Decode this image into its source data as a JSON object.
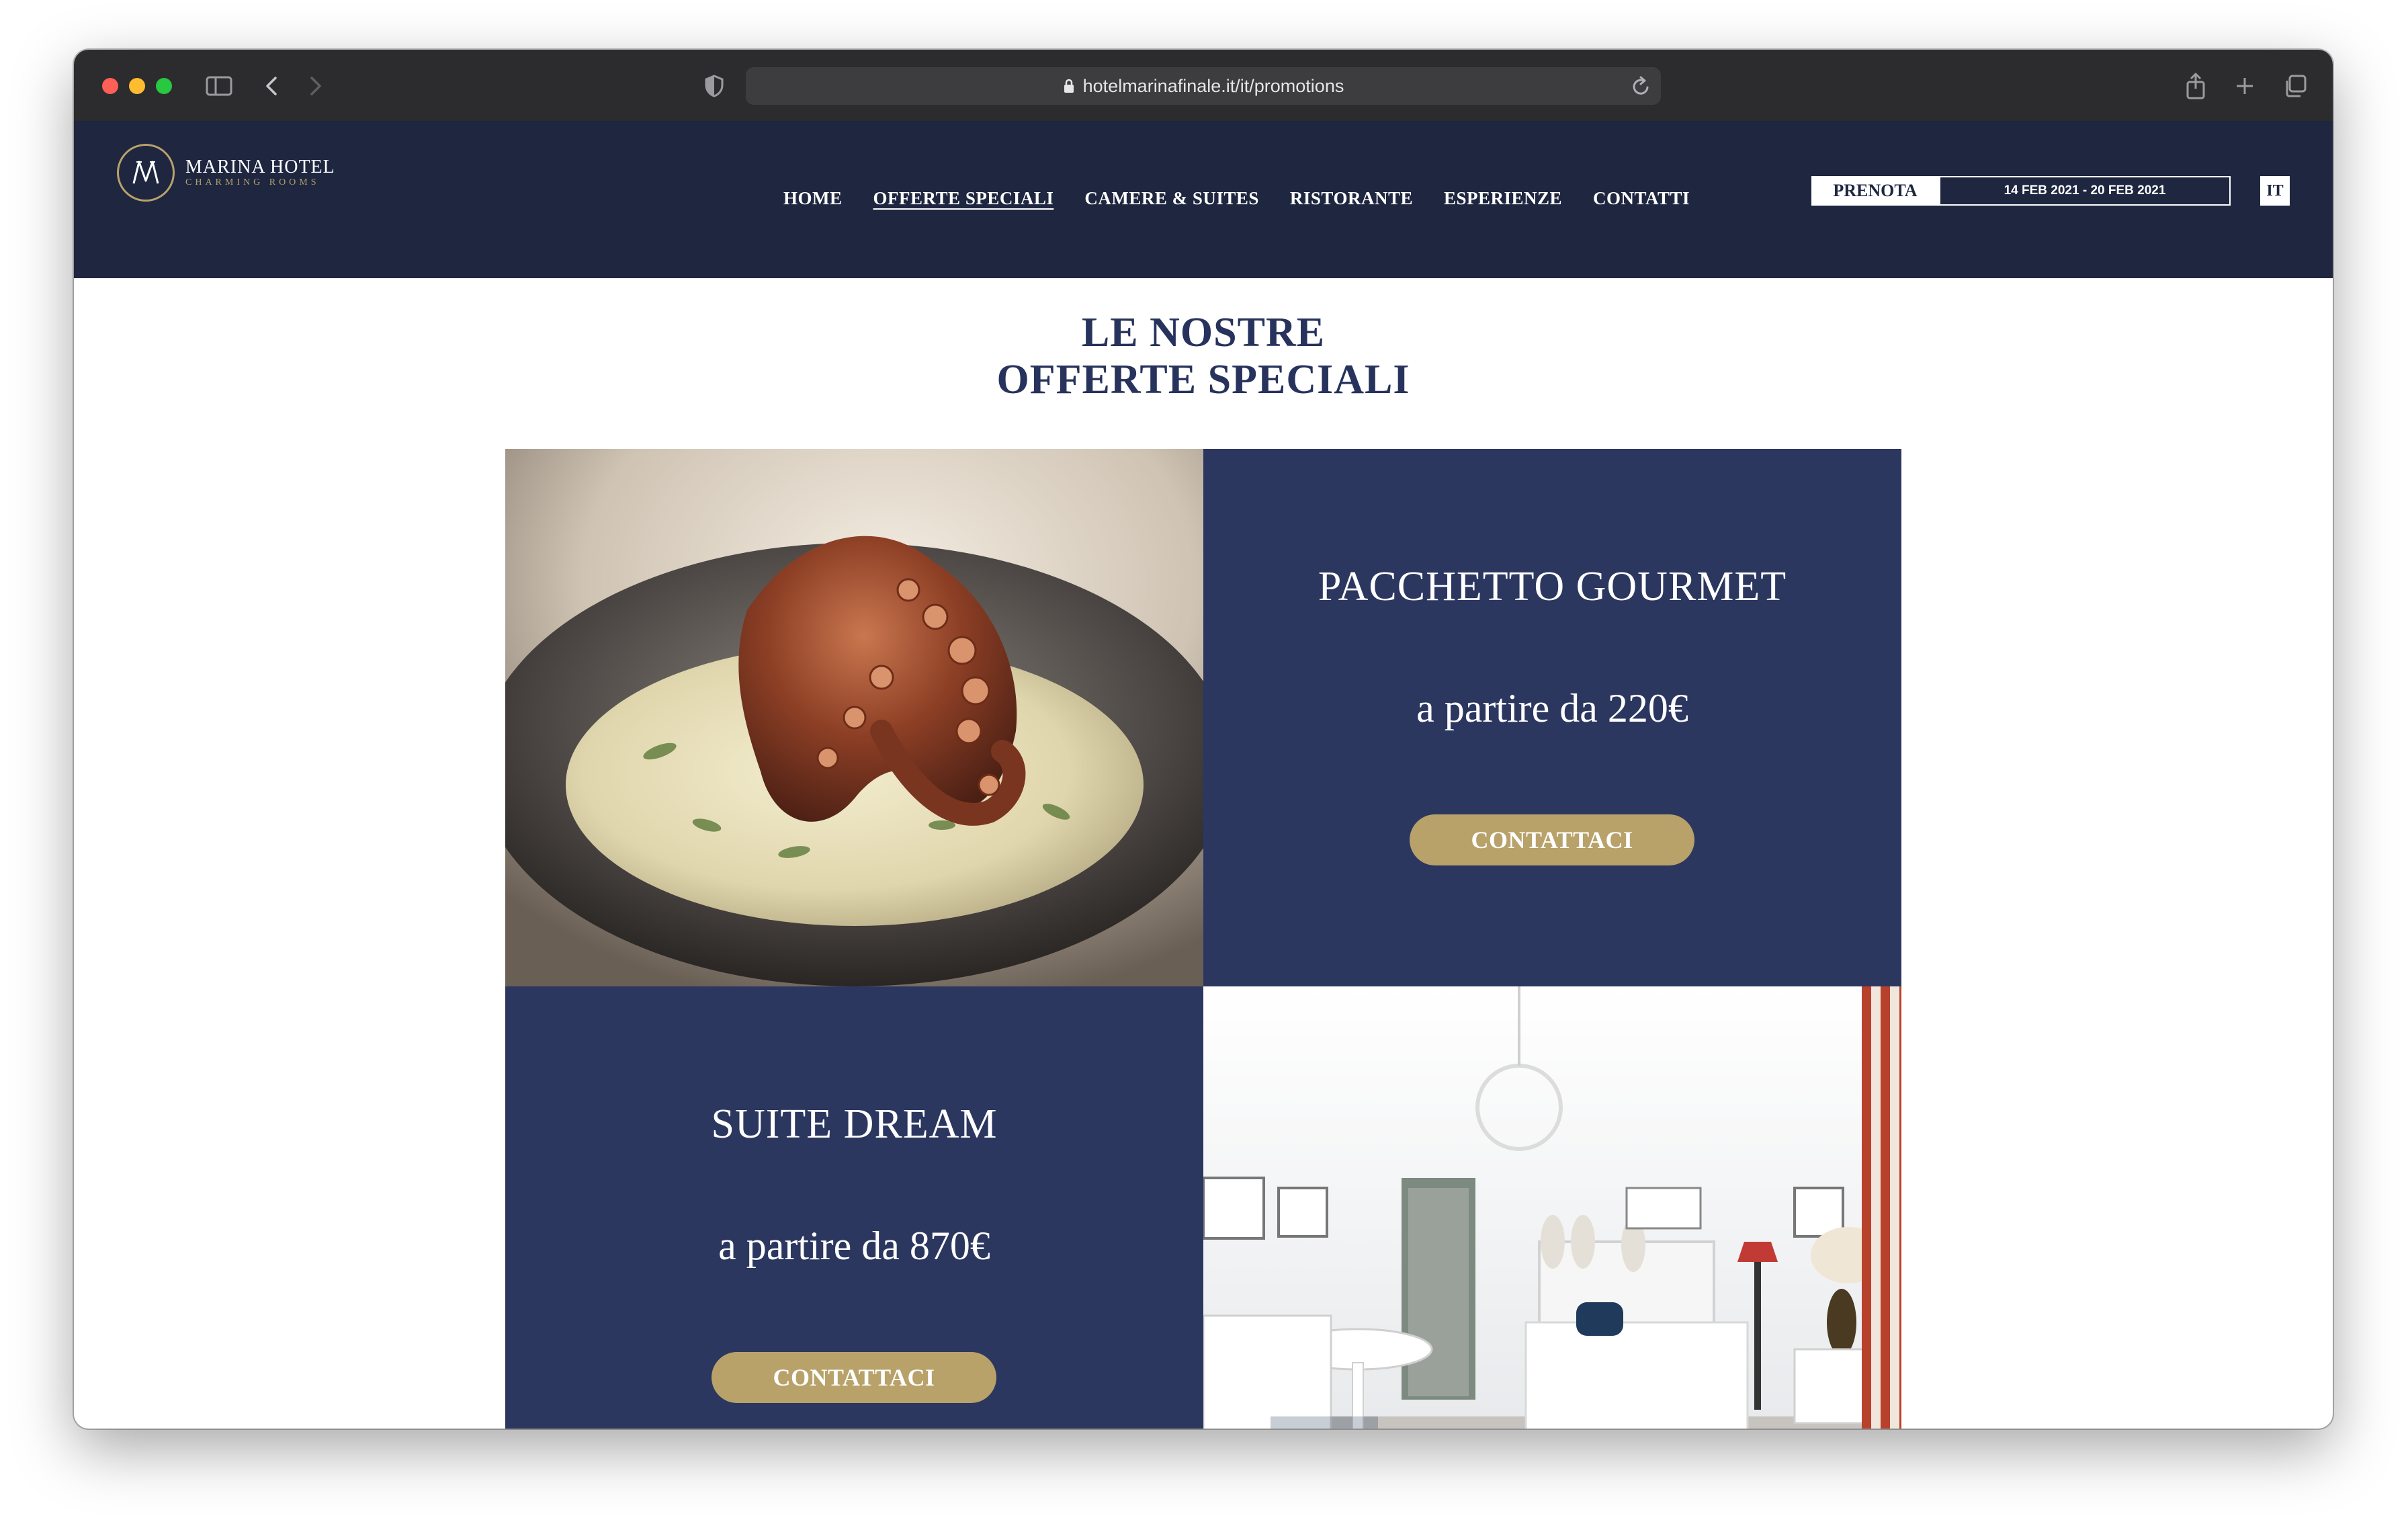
{
  "browser": {
    "url": "hotelmarinafinale.it/it/promotions"
  },
  "site": {
    "logo": {
      "title": "MARINA HOTEL",
      "subtitle": "CHARMING ROOMS"
    },
    "nav": [
      {
        "label": "HOME"
      },
      {
        "label": "OFFERTE SPECIALI",
        "active": true
      },
      {
        "label": "CAMERE & SUITES"
      },
      {
        "label": "RISTORANTE"
      },
      {
        "label": "ESPERIENZE"
      },
      {
        "label": "CONTATTI"
      }
    ],
    "booking": {
      "button_label": "PRENOTA",
      "dates": "14 FEB 2021 - 20 FEB 2021"
    },
    "language": "IT"
  },
  "main": {
    "title_line1": "LE NOSTRE",
    "title_line2": "OFFERTE SPECIALI",
    "offers": [
      {
        "name": "PACCHETTO GOURMET",
        "price": "a partire da 220€",
        "cta": "CONTATTACI",
        "image": "octopus-dish-photo"
      },
      {
        "name": "SUITE DREAM",
        "price": "a partire da 870€",
        "cta": "CONTATTACI",
        "image": "suite-bedroom-photo"
      }
    ]
  },
  "colors": {
    "header_bg": "#1e2640",
    "tile_navy": "#2c3760",
    "title_navy": "#27335c",
    "gold": "#b8a26a"
  }
}
